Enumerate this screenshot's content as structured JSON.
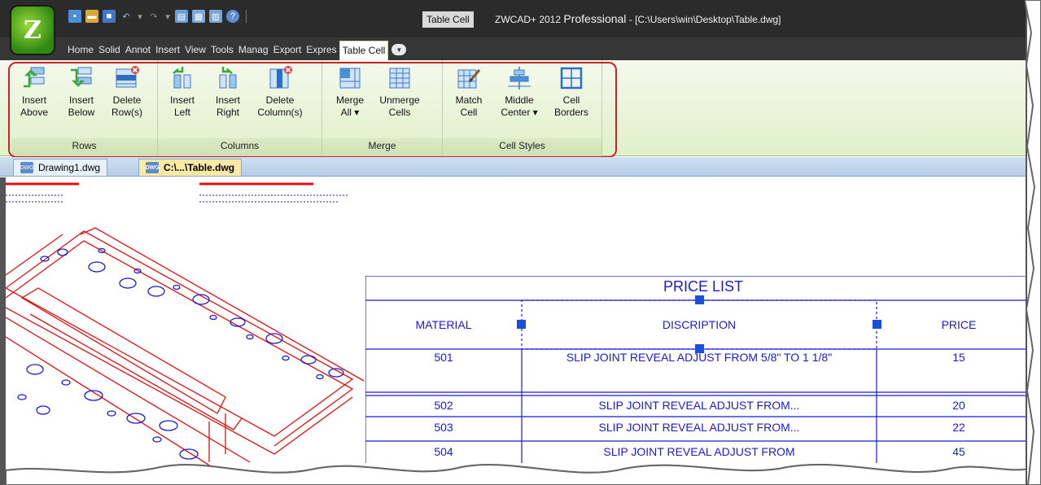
{
  "titlebar": {
    "logo_glyph": "Z",
    "context_tab": "Table Cell",
    "app_name": "ZWCAD+ 2012",
    "edition": "Professional",
    "file_path": " - [C:\\Users\\win\\Desktop\\Table.dwg]",
    "qat_icons": [
      "new-icon",
      "open-icon",
      "save-icon",
      "undo-icon",
      "redo-icon",
      "print-icon",
      "plot-icon",
      "publish-icon",
      "help-icon"
    ]
  },
  "tabs": [
    "Home",
    "Solid",
    "Annot",
    "Insert",
    "View",
    "Tools",
    "Manag",
    "Export",
    "Expres",
    "Table Cell"
  ],
  "ribbon": {
    "panels": {
      "rows": "Rows",
      "columns": "Columns",
      "merge": "Merge",
      "cell_styles": "Cell Styles"
    },
    "buttons": {
      "insert_above": "Insert\nAbove",
      "insert_below": "Insert\nBelow",
      "delete_rows": "Delete\nRow(s)",
      "insert_left": "Insert\nLeft",
      "insert_right": "Insert\nRight",
      "delete_columns": "Delete\nColumn(s)",
      "merge_all": "Merge\nAll ▾",
      "unmerge_cells": "Unmerge\nCells",
      "match_cell": "Match\nCell",
      "middle_center": "Middle\nCenter ▾",
      "cell_borders": "Cell\nBorders"
    }
  },
  "doc_tabs": [
    {
      "label": "Drawing1.dwg",
      "active": false
    },
    {
      "label": "C:\\...\\Table.dwg",
      "active": true
    }
  ],
  "dwg_icon_text": "DWG",
  "price_table": {
    "title": "PRICE LIST",
    "headers": [
      "MATERIAL",
      "DISCRIPTION",
      "PRICE"
    ],
    "rows": [
      {
        "material": "501",
        "description": "SLIP JOINT REVEAL ADJUST FROM 5/8\" TO 1 1/8\"",
        "price": "15"
      },
      {
        "material": "502",
        "description": "SLIP JOINT REVEAL ADJUST FROM...",
        "price": "20"
      },
      {
        "material": "503",
        "description": "SLIP JOINT REVEAL ADJUST FROM...",
        "price": "22"
      },
      {
        "material": "504",
        "description": "SLIP JOINT REVEAL ADJUST FROM",
        "price": "45"
      }
    ]
  },
  "colors": {
    "table_blue": "#1a1ad6",
    "drawing_red": "#e01010",
    "highlight_red": "#c8232a",
    "ribbon_green": "#e1f0c9"
  }
}
